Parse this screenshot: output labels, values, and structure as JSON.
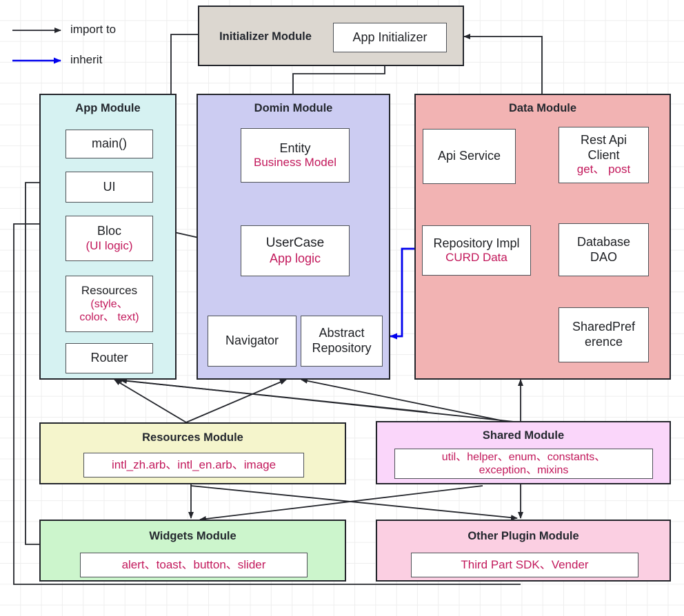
{
  "legend": {
    "import_label": "import to",
    "inherit_label": "inherit",
    "import_color": "#23252b",
    "inherit_color": "#0000ee"
  },
  "modules": {
    "initializer": {
      "title": "Initializer Module",
      "fill": "#dcd7d0",
      "boxes": [
        {
          "line1": "App Initializer"
        }
      ]
    },
    "app": {
      "title": "App Module",
      "fill": "#d6f2f2",
      "boxes": [
        {
          "line1": "main()"
        },
        {
          "line1": "UI"
        },
        {
          "line1": "Bloc",
          "line2": "(UI logic)"
        },
        {
          "line1": "Resources",
          "line2": "(style、",
          "line3": "color、 text)"
        },
        {
          "line1": "Router"
        }
      ]
    },
    "domain": {
      "title": "Domin Module",
      "fill": "#ccccf2",
      "boxes": [
        {
          "line1": "Entity",
          "line2": "Business Model"
        },
        {
          "line1": "UserCase",
          "line2": "App logic"
        },
        {
          "line1": "Navigator"
        },
        {
          "line1": "Abstract",
          "line1b": "Repository"
        }
      ]
    },
    "data": {
      "title": "Data Module",
      "fill": "#f2b3b3",
      "boxes": [
        {
          "line1": "Api Service"
        },
        {
          "line1": "Rest Api",
          "line1b": "Client",
          "line2": "get、 post"
        },
        {
          "line1": "Repository Impl",
          "line2": "CURD Data"
        },
        {
          "line1": "Database",
          "line1b": "DAO"
        },
        {
          "line1": "SharedPref",
          "line1b": "erence"
        }
      ]
    },
    "resources": {
      "title": "Resources Module",
      "fill": "#f5f5cc",
      "content": "intl_zh.arb、intl_en.arb、image"
    },
    "shared": {
      "title": "Shared Module",
      "fill": "#fad6fa",
      "content_line1": "util、helper、enum、constants、",
      "content_line2": "exception、mixins"
    },
    "widgets": {
      "title": "Widgets Module",
      "fill": "#ccf5cc",
      "content": "alert、toast、button、slider"
    },
    "plugin": {
      "title": "Other Plugin Module",
      "fill": "#fbcfe2",
      "content": "Third Part SDK、Vender"
    }
  }
}
